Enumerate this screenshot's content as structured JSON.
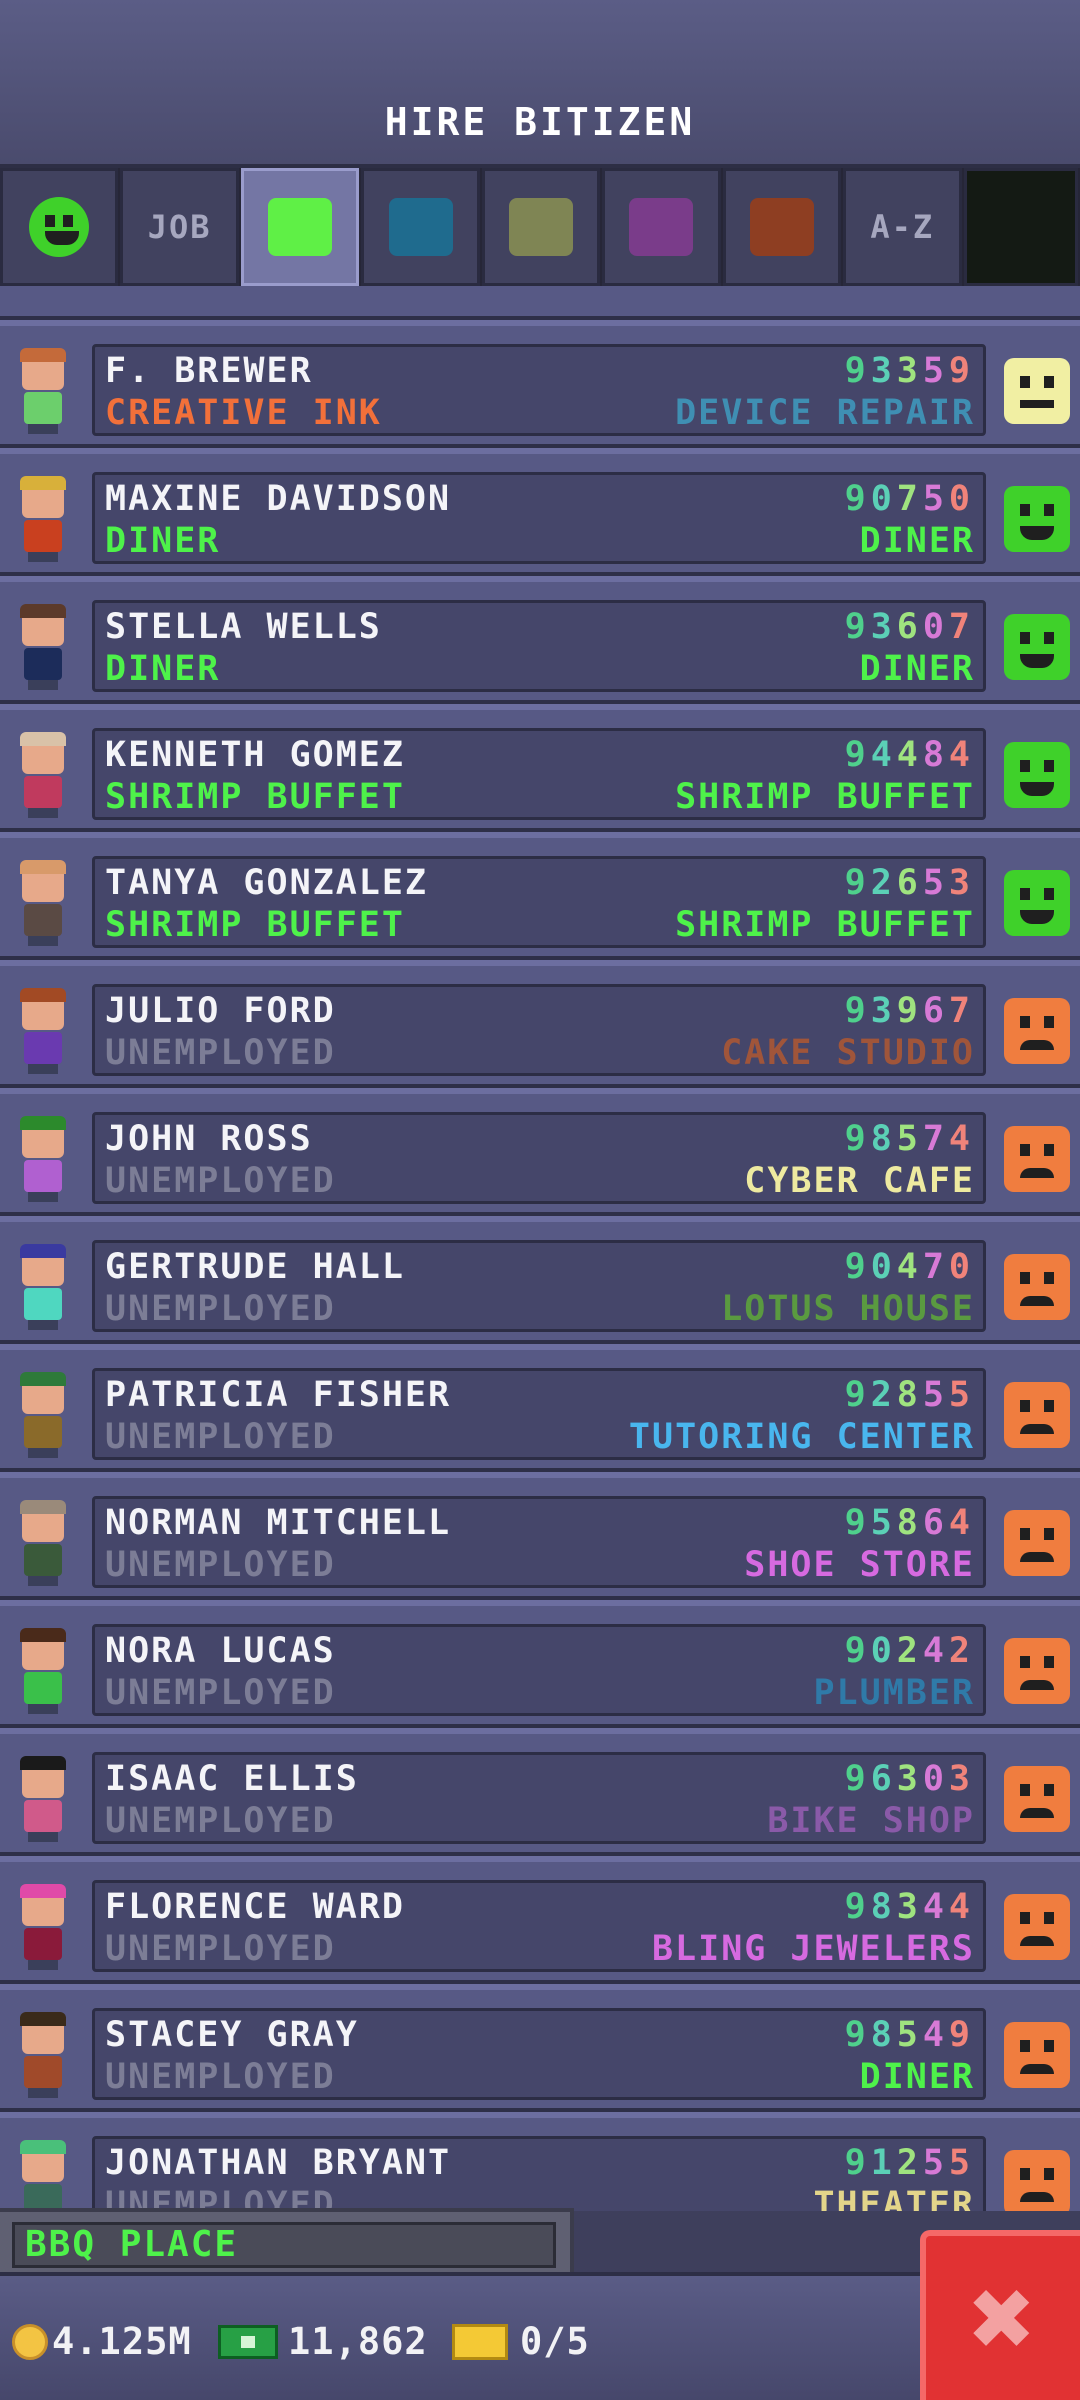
{
  "header": {
    "title": "HIRE BITIZEN"
  },
  "tabs": [
    {
      "kind": "face",
      "icon": "happy-face-icon",
      "color": "#3fd12a"
    },
    {
      "kind": "text",
      "label": "JOB"
    },
    {
      "kind": "swatch",
      "color": "#5ff046",
      "active": true
    },
    {
      "kind": "swatch",
      "color": "#1f6b8e"
    },
    {
      "kind": "swatch",
      "color": "#7f8554"
    },
    {
      "kind": "swatch",
      "color": "#7a3c8a"
    },
    {
      "kind": "swatch",
      "color": "#8e3e22"
    },
    {
      "kind": "text",
      "label": "A-Z"
    }
  ],
  "colors": {
    "green": "#4ef24a",
    "orange": "#f07d3f",
    "unemployed": "#7c7d96"
  },
  "bitizens": [
    {
      "name": "F. BREWER",
      "current_job": "CREATIVE INK",
      "current_color": "#f2703a",
      "number": "93359",
      "dream_job": "DEVICE REPAIR",
      "dream_color": "#3f8fb3",
      "mood": "neutral",
      "hair": "#c46a3a",
      "shirt": "#6ccf6c"
    },
    {
      "name": "MAXINE DAVIDSON",
      "current_job": "DINER",
      "current_color": "#4ef24a",
      "number": "90750",
      "dream_job": "DINER",
      "dream_color": "#4ef24a",
      "mood": "happy",
      "hair": "#d8b03a",
      "shirt": "#c9401f"
    },
    {
      "name": "STELLA WELLS",
      "current_job": "DINER",
      "current_color": "#4ef24a",
      "number": "93607",
      "dream_job": "DINER",
      "dream_color": "#4ef24a",
      "mood": "happy",
      "hair": "#5c3a2a",
      "shirt": "#1c2c5a"
    },
    {
      "name": "KENNETH GOMEZ",
      "current_job": "SHRIMP BUFFET",
      "current_color": "#4ef24a",
      "number": "94484",
      "dream_job": "SHRIMP BUFFET",
      "dream_color": "#4ef24a",
      "mood": "happy",
      "hair": "#d9c2a8",
      "shirt": "#c03a5e"
    },
    {
      "name": "TANYA GONZALEZ",
      "current_job": "SHRIMP BUFFET",
      "current_color": "#4ef24a",
      "number": "92653",
      "dream_job": "SHRIMP BUFFET",
      "dream_color": "#4ef24a",
      "mood": "happy",
      "hair": "#d89a6a",
      "shirt": "#5a4a44"
    },
    {
      "name": "JULIO FORD",
      "current_job": "UNEMPLOYED",
      "current_color": "#7c7d96",
      "number": "93967",
      "dream_job": "CAKE STUDIO",
      "dream_color": "#a0553a",
      "mood": "sad",
      "hair": "#a24a24",
      "shirt": "#6a3ab0"
    },
    {
      "name": "JOHN ROSS",
      "current_job": "UNEMPLOYED",
      "current_color": "#7c7d96",
      "number": "98574",
      "dream_job": "CYBER CAFE",
      "dream_color": "#eeeaa0",
      "mood": "sad",
      "hair": "#2c8a2c",
      "shirt": "#b060d0"
    },
    {
      "name": "GERTRUDE HALL",
      "current_job": "UNEMPLOYED",
      "current_color": "#7c7d96",
      "number": "90470",
      "dream_job": "LOTUS HOUSE",
      "dream_color": "#5a9a40",
      "mood": "sad",
      "hair": "#3a3aa0",
      "shirt": "#4fd7c0"
    },
    {
      "name": "PATRICIA FISHER",
      "current_job": "UNEMPLOYED",
      "current_color": "#7c7d96",
      "number": "92855",
      "dream_job": "TUTORING CENTER",
      "dream_color": "#49b6ee",
      "mood": "sad",
      "hair": "#2e7a3a",
      "shirt": "#8a6a2a"
    },
    {
      "name": "NORMAN MITCHELL",
      "current_job": "UNEMPLOYED",
      "current_color": "#7c7d96",
      "number": "95864",
      "dream_job": "SHOE STORE",
      "dream_color": "#d66ae0",
      "mood": "sad",
      "hair": "#9a8a7a",
      "shirt": "#3a5a3a"
    },
    {
      "name": "NORA LUCAS",
      "current_job": "UNEMPLOYED",
      "current_color": "#7c7d96",
      "number": "90242",
      "dream_job": "PLUMBER",
      "dream_color": "#2f7aa8",
      "mood": "sad",
      "hair": "#4a2a1a",
      "shirt": "#3ac04a"
    },
    {
      "name": "ISAAC ELLIS",
      "current_job": "UNEMPLOYED",
      "current_color": "#7c7d96",
      "number": "96303",
      "dream_job": "BIKE SHOP",
      "dream_color": "#8a5aa8",
      "mood": "sad",
      "hair": "#1a1a1a",
      "shirt": "#d05a8a"
    },
    {
      "name": "FLORENCE WARD",
      "current_job": "UNEMPLOYED",
      "current_color": "#7c7d96",
      "number": "98344",
      "dream_job": "BLING JEWELERS",
      "dream_color": "#d66ae0",
      "mood": "sad",
      "hair": "#e04aa8",
      "shirt": "#8a1a3a"
    },
    {
      "name": "STACEY GRAY",
      "current_job": "UNEMPLOYED",
      "current_color": "#7c7d96",
      "number": "98549",
      "dream_job": "DINER",
      "dream_color": "#4ef24a",
      "mood": "sad",
      "hair": "#3a2a1a",
      "shirt": "#a04a2a"
    },
    {
      "name": "JONATHAN BRYANT",
      "current_job": "UNEMPLOYED",
      "current_color": "#7c7d96",
      "number": "91255",
      "dream_job": "THEATER",
      "dream_color": "#e3d58a",
      "mood": "sad",
      "hair": "#4ac07a",
      "shirt": "#3a6a5a"
    }
  ],
  "building": {
    "label": "BBQ PLACE"
  },
  "footer": {
    "coins": "4.125M",
    "bux": "11,862",
    "tickets": "0/5"
  },
  "close": {
    "label": "✖"
  }
}
